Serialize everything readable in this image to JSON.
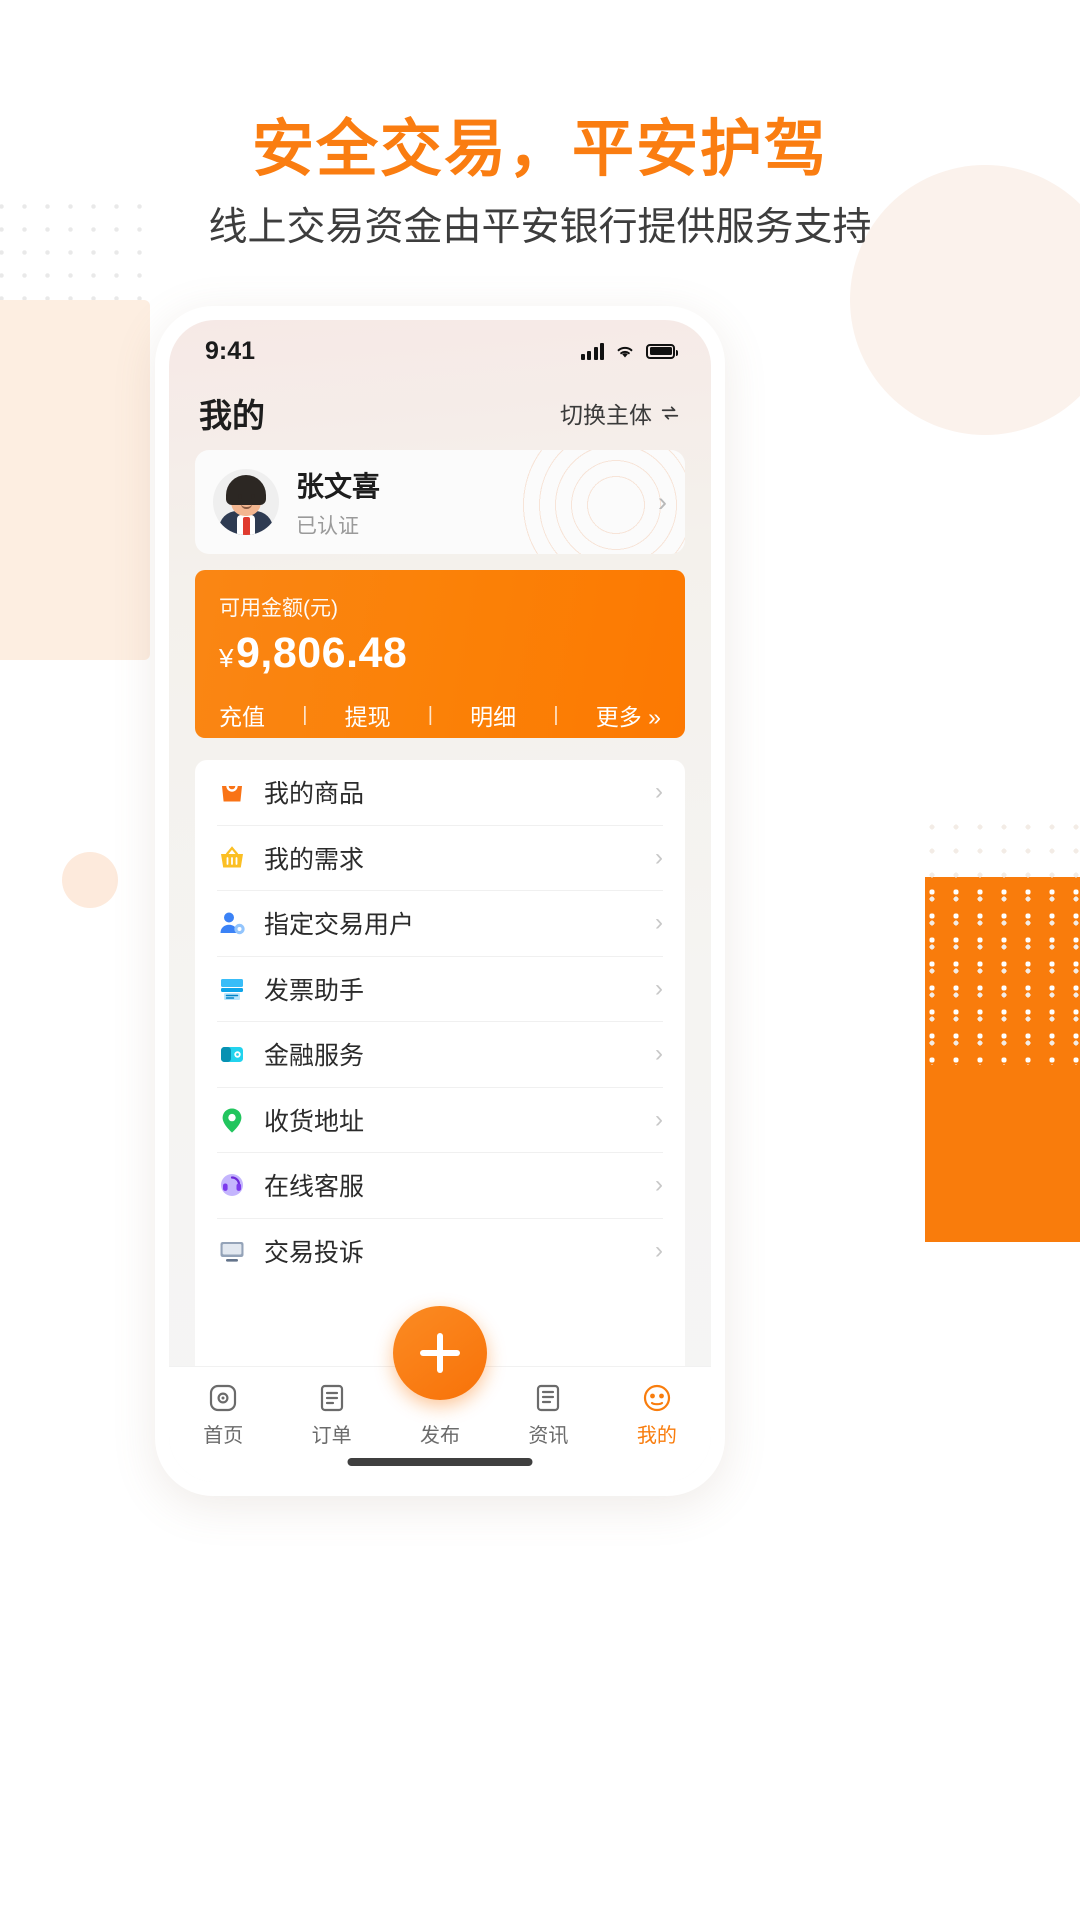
{
  "promo": {
    "headline": "安全交易，平安护驾",
    "subline": "线上交易资金由平安银行提供服务支持",
    "accent_color": "#fa7d11"
  },
  "phone": {
    "status_bar": {
      "time": "9:41",
      "signal_icon": "cellular-signal-icon",
      "wifi_icon": "wifi-icon",
      "battery_icon": "battery-full-icon"
    },
    "header": {
      "title": "我的",
      "switch_entity_label": "切换主体",
      "switch_entity_icon": "swap-arrows-icon"
    },
    "profile": {
      "name": "张文喜",
      "status": "已认证",
      "avatar_icon": "user-avatar",
      "chevron_icon": "chevron-right-icon"
    },
    "balance": {
      "label": "可用金额(元)",
      "currency_symbol": "¥",
      "amount": "9,806.48",
      "card_color": "#fa8110",
      "actions": [
        {
          "label": "充值",
          "name": "recharge"
        },
        {
          "label": "提现",
          "name": "withdraw"
        },
        {
          "label": "明细",
          "name": "details"
        },
        {
          "label": "更多 »",
          "name": "more"
        }
      ],
      "separator": "|"
    },
    "menu": [
      {
        "label": "我的商品",
        "icon": "shopping-bag-icon",
        "color": "#f97316"
      },
      {
        "label": "我的需求",
        "icon": "basket-icon",
        "color": "#fbbf24"
      },
      {
        "label": "指定交易用户",
        "icon": "user-settings-icon",
        "color": "#3b82f6"
      },
      {
        "label": "发票助手",
        "icon": "invoice-icon",
        "color": "#38bdf8"
      },
      {
        "label": "金融服务",
        "icon": "wallet-icon",
        "color": "#22d3ee"
      },
      {
        "label": "收货地址",
        "icon": "location-pin-icon",
        "color": "#22c55e"
      },
      {
        "label": "在线客服",
        "icon": "headset-icon",
        "color": "#8b5cf6"
      },
      {
        "label": "交易投诉",
        "icon": "monitor-icon",
        "color": "#64748b"
      }
    ],
    "tabs": [
      {
        "label": "首页",
        "icon": "home-icon",
        "active": false
      },
      {
        "label": "订单",
        "icon": "order-icon",
        "active": false
      },
      {
        "label": "发布",
        "icon": "publish-icon",
        "active": false
      },
      {
        "label": "资讯",
        "icon": "news-icon",
        "active": false
      },
      {
        "label": "我的",
        "icon": "profile-icon",
        "active": true
      }
    ],
    "fab": {
      "icon": "plus-icon"
    }
  }
}
